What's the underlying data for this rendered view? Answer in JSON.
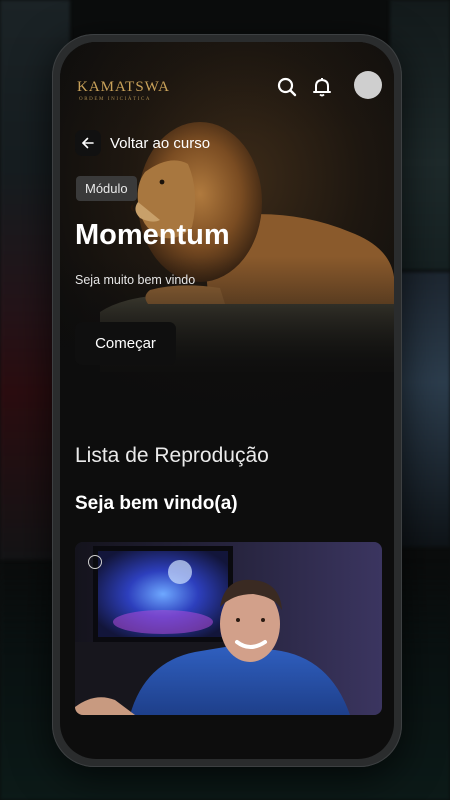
{
  "app": {
    "brand_name": "KAMATSWA",
    "brand_tagline": "ORDEM INICIÁTICA",
    "accent_color": "#c9a25a"
  },
  "header": {
    "icons": [
      "search-icon",
      "bell-icon",
      "avatar"
    ]
  },
  "nav": {
    "back_label": "Voltar ao curso"
  },
  "module": {
    "badge": "Módulo",
    "title": "Momentum",
    "subtitle": "Seja muito bem vindo",
    "start_label": "Começar"
  },
  "playlist": {
    "heading": "Lista de Reprodução",
    "section_title": "Seja bem vindo(a)"
  }
}
